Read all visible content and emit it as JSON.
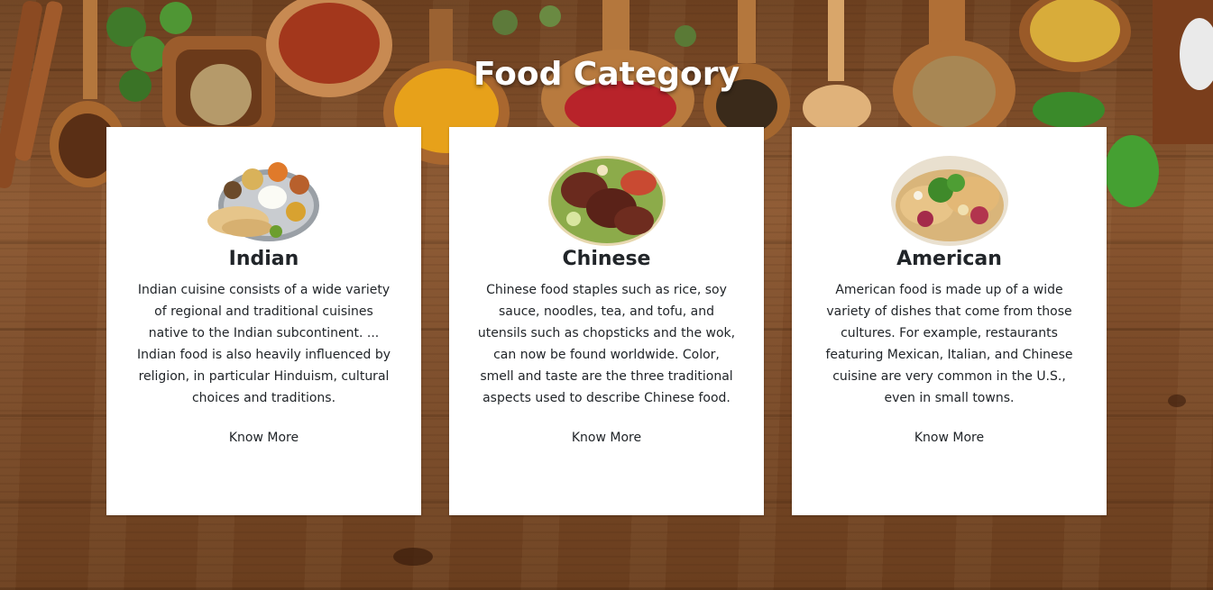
{
  "page": {
    "title": "Food Category"
  },
  "cards": [
    {
      "title": "Indian",
      "text": "Indian cuisine consists of a wide variety of regional and traditional cuisines native to the Indian subcontinent. ... Indian food is also heavily influenced by religion, in particular Hinduism, cultural choices and traditions.",
      "link_label": "Know More"
    },
    {
      "title": "Chinese",
      "text": "Chinese food staples such as rice, soy sauce, noodles, tea, and tofu, and utensils such as chopsticks and the wok, can now be found worldwide. Color, smell and taste are the three traditional aspects used to describe Chinese food.",
      "link_label": "Know More"
    },
    {
      "title": "American",
      "text": "American food is made up of a wide variety of dishes that come from those cultures. For example, restaurants featuring Mexican, Italian, and Chinese cuisine are very common in the U.S., even in small towns.",
      "link_label": "Know More"
    }
  ],
  "colors": {
    "card_background": "#ffffff",
    "text": "#212529",
    "title": "#ffffff"
  }
}
